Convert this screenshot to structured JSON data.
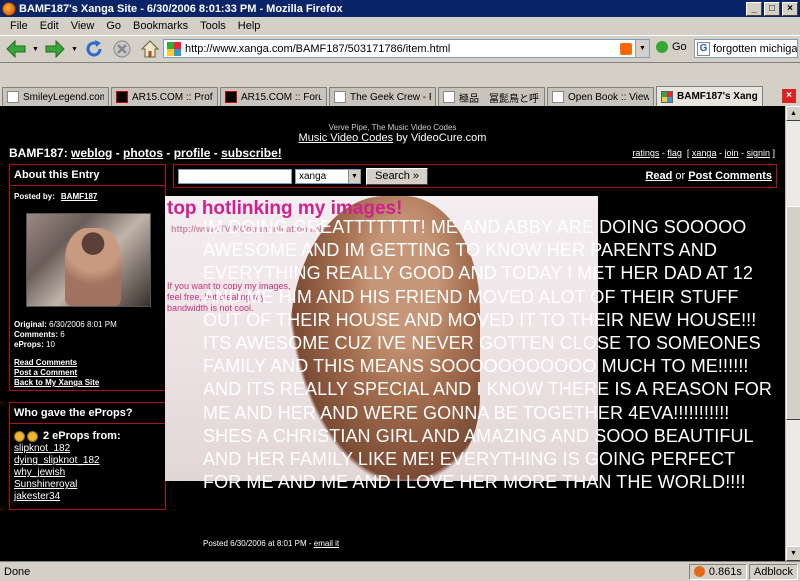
{
  "window": {
    "title": "BAMF187's Xanga Site - 6/30/2006 8:01:33 PM - Mozilla Firefox",
    "min_label": "_",
    "max_label": "□",
    "close_label": "×"
  },
  "menu": [
    "File",
    "Edit",
    "View",
    "Go",
    "Bookmarks",
    "Tools",
    "Help"
  ],
  "toolbar": {
    "url": "http://www.xanga.com/BAMF187/503171786/item.html",
    "go_label": "Go",
    "search_query": "forgotten michigan",
    "search_engine_letter": "G"
  },
  "tabs": [
    {
      "label": "SmileyLegend.com - ...",
      "icon": "doc"
    },
    {
      "label": "AR15.COM :: Profile...",
      "icon": "ar"
    },
    {
      "label": "AR15.COM :: Forum...",
      "icon": "ar"
    },
    {
      "label": "The Geek Crew - Po...",
      "icon": "doc"
    },
    {
      "label": "極品　冨髭鳥と呼...",
      "icon": "doc"
    },
    {
      "label": "Open Book :: View t...",
      "icon": "doc"
    },
    {
      "label": "BAMF187's Xanga...",
      "icon": "x",
      "active": true
    }
  ],
  "page": {
    "promo_line1": "Verve Pipe, The Music Video Codes",
    "promo_link": "Music Video Codes",
    "promo_by": " by VideoCure.com",
    "site_name": "BAMF187",
    "nav": [
      "weblog",
      "photos",
      "profile",
      "subscribe!"
    ],
    "top_links": [
      "ratings",
      "flag",
      "xanga",
      "join",
      "signin"
    ],
    "about": {
      "heading": "About this Entry",
      "posted_by_label": "Posted by:",
      "posted_by": "BAMF187",
      "original_label": "Original:",
      "original": "6/30/2006 8:01 PM",
      "comments_label": "Comments:",
      "comments": "6",
      "eprops_label": "eProps:",
      "eprops": "10",
      "links": [
        "Read Comments",
        "Post a Comment",
        "Back to My Xanga Site"
      ]
    },
    "eprops_box": {
      "heading": "Who gave the eProps?",
      "count_text": "2 eProps from:",
      "givers": [
        "slipknot_182",
        "dying_slipknot_182",
        "why_jewish",
        "Sunshineroyal",
        "jakester34"
      ]
    },
    "search": {
      "select_value": "xanga",
      "button": "Search »"
    },
    "post_links": {
      "read": "Read",
      "or": " or ",
      "post": "Post Comments"
    },
    "image": {
      "hotlink_text": "top hotlinking my images!",
      "watermark": "http://www.TV NCommunications.Net",
      "note": "If you want to copy my images, feel free, but stealing my bandwidth is not cool."
    },
    "post_text": "IM DOING GREATTTTTTT! ME AND ABBY ARE DOING SOOOOO AWESOME AND IM GETTING TO KNOW HER PARENTS AND EVERYTHING REALLY GOOD AND TODAY I MET HER DAD AT 12 AND ME HIM AND HIS FRIEND MOVED ALOT OF THEIR STUFF OUT OF THEIR HOUSE AND MOVED IT TO THEIR NEW HOUSE!!! ITS AWESOME CUZ IVE NEVER GOTTEN CLOSE TO SOMEONES FAMILY AND THIS MEANS SOOOOOOOOOOO MUCH TO ME!!!!!! AND ITS REALLY SPECIAL AND I KNOW THERE IS A REASON FOR ME AND HER AND WERE GONNA BE TOGETHER 4EVA!!!!!!!!!!! SHES A CHRISTIAN GIRL AND AMAZING AND SOOO BEAUTIFUL AND HER FAMILY LIKE ME! EVERYTHING IS GOING PERFECT FOR ME AND ME AND I LOVE HER MORE THAN THE WORLD!!!!",
    "footer_prefix": "Posted 6/30/2006 at 8:01 PM - ",
    "footer_link": "email it"
  },
  "status": {
    "text": "Done",
    "time": "0.861s",
    "adblock": "Adblock"
  }
}
